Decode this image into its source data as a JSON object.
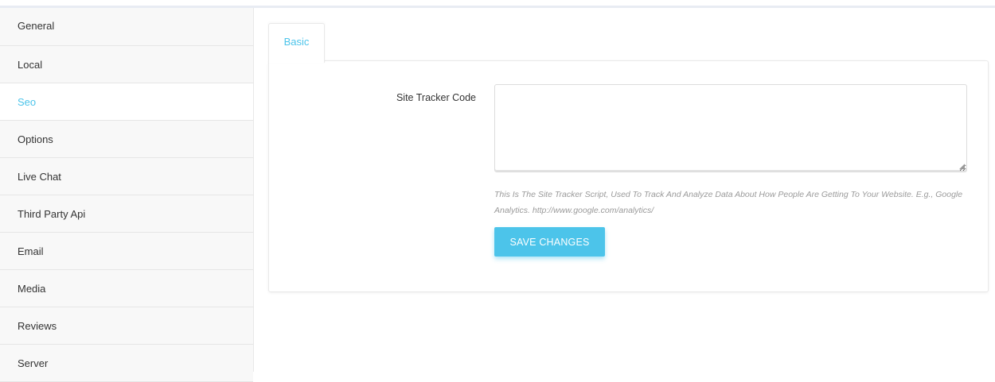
{
  "sidebar": {
    "items": [
      {
        "label": "General",
        "active": false
      },
      {
        "label": "Local",
        "active": false
      },
      {
        "label": "Seo",
        "active": true
      },
      {
        "label": "Options",
        "active": false
      },
      {
        "label": "Live Chat",
        "active": false
      },
      {
        "label": "Third Party Api",
        "active": false
      },
      {
        "label": "Email",
        "active": false
      },
      {
        "label": "Media",
        "active": false
      },
      {
        "label": "Reviews",
        "active": false
      },
      {
        "label": "Server",
        "active": false
      }
    ]
  },
  "tabs": [
    {
      "label": "Basic",
      "active": true
    }
  ],
  "form": {
    "tracker_label": "Site Tracker Code",
    "tracker_value": "",
    "help_text": "This Is The Site Tracker Script, Used To Track And Analyze Data About How People Are Getting To Your Website. E.g., Google Analytics. http://www.google.com/analytics/",
    "save_label": "SAVE CHANGES"
  },
  "colors": {
    "accent": "#4cc4ea",
    "sidebar_bg": "#f8f8f8"
  }
}
